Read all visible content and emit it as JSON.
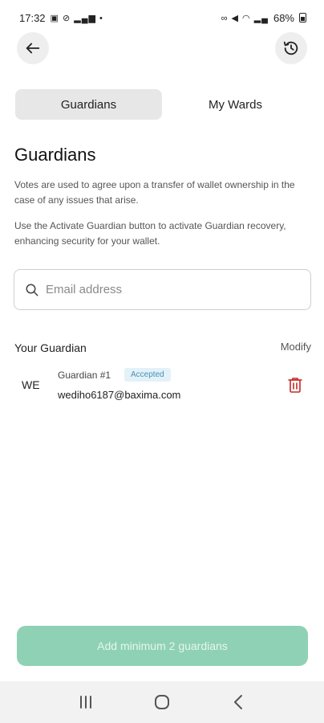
{
  "status_bar": {
    "time": "17:32",
    "battery": "68%"
  },
  "tabs": [
    {
      "label": "Guardians",
      "active": true
    },
    {
      "label": "My Wards",
      "active": false
    }
  ],
  "page": {
    "title": "Guardians",
    "description_1": "Votes are used to agree upon a transfer of wallet ownership in the case of any issues that arise.",
    "description_2": "Use the Activate Guardian button to activate Guardian recovery, enhancing security for your wallet."
  },
  "search": {
    "placeholder": "Email address",
    "value": ""
  },
  "guardians_section": {
    "title": "Your Guardian",
    "modify_label": "Modify",
    "items": [
      {
        "initials": "WE",
        "name": "Guardian #1",
        "status": "Accepted",
        "email": "wediho6187@baxima.com"
      }
    ]
  },
  "primary_button": {
    "label": "Add minimum 2 guardians",
    "disabled": true
  },
  "colors": {
    "accent_disabled": "#8fd1b4",
    "delete": "#c62828",
    "badge_bg": "#e3f2f9",
    "badge_text": "#4a8fb5"
  },
  "icons": {
    "back": "arrow-left-icon",
    "history": "history-icon",
    "search": "search-icon",
    "delete": "trash-icon",
    "nav_recents": "recents-icon",
    "nav_home": "home-icon",
    "nav_back": "chevron-left-icon"
  }
}
